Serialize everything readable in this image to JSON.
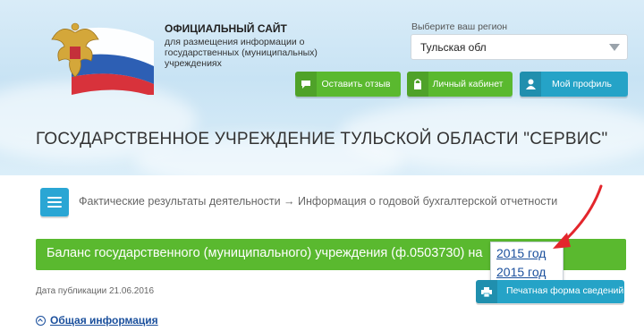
{
  "header": {
    "site_title": "ОФИЦИАЛЬНЫЙ САЙТ",
    "site_subtitle": "для размещения информации о государственных (муниципальных) учреждениях",
    "region_label": "Выберите ваш регион",
    "region_value": "Тульская обл",
    "buttons": {
      "feedback": "Оставить отзыв",
      "cabinet": "Личный кабинет",
      "profile": "Мой профиль"
    }
  },
  "org_title": "ГОСУДАРСТВЕННОЕ УЧРЕЖДЕНИЕ ТУЛЬСКОЙ ОБЛАСТИ \"СЕРВИС\"",
  "breadcrumb": "Фактические результаты деятельности → Информация о годовой бухгалтерской отчетности",
  "report_bar": {
    "title": "Баланс государственного (муниципального) учреждения (ф.0503730) на",
    "year_options": [
      "2015 год",
      "2015 год"
    ]
  },
  "publication_date": "Дата публикации 21.06.2016",
  "print_button": "Печатная форма сведений",
  "general_info": "Общая информация",
  "colors": {
    "green": "#5ab92f",
    "teal": "#25a3c7",
    "link": "#1a4f9c",
    "annotation_arrow": "#e3262c"
  },
  "icons": [
    "coat-of-arms-icon",
    "chat-icon",
    "lock-icon",
    "user-icon",
    "menu-icon",
    "print-icon",
    "chevron-up-icon"
  ]
}
